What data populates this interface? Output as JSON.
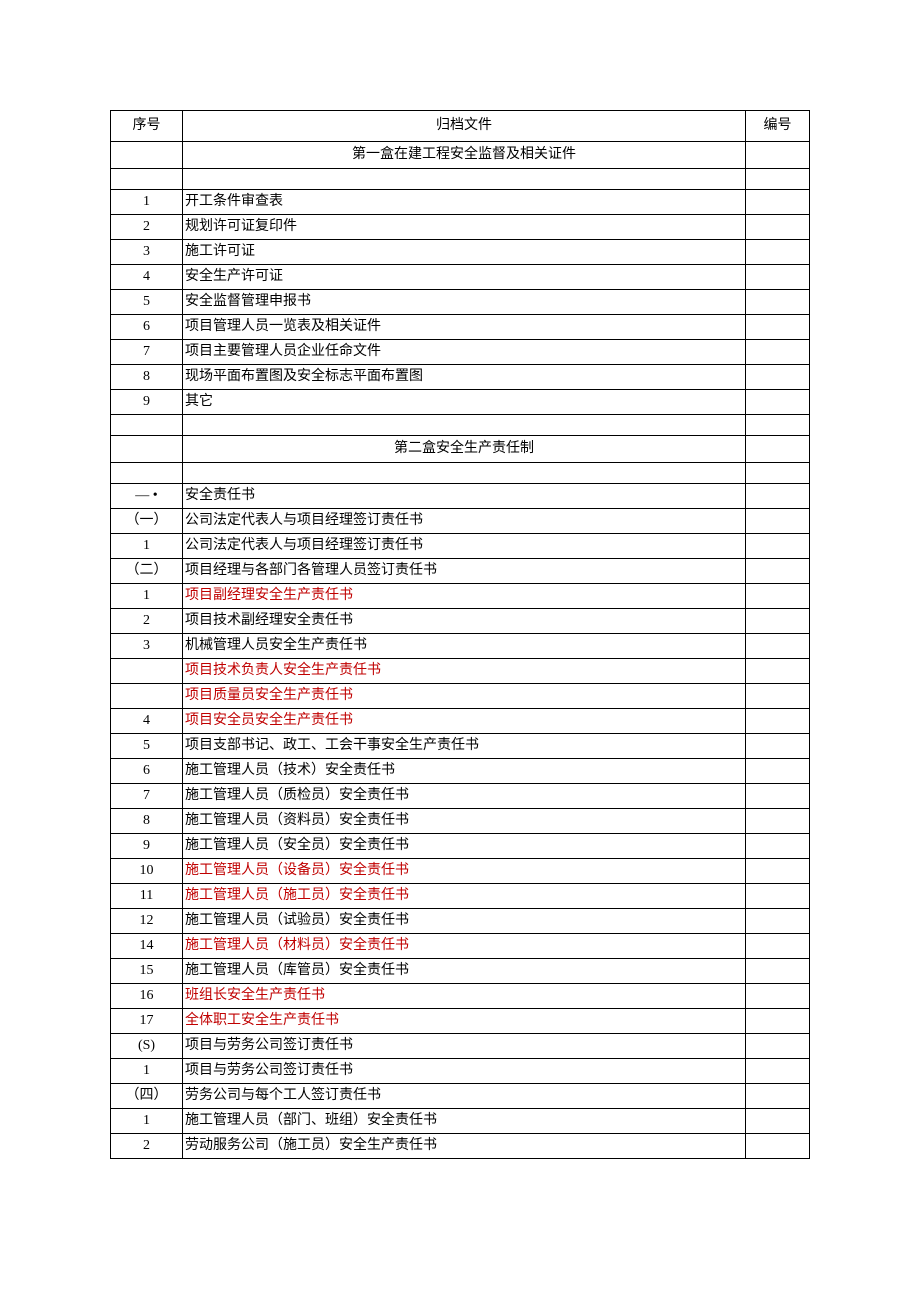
{
  "headers": {
    "seq": "序号",
    "doc": "归档文件",
    "num": "编号"
  },
  "rows": [
    {
      "type": "section",
      "doc": "第一盒在建工程安全监督及相关证件"
    },
    {
      "type": "empty"
    },
    {
      "type": "data",
      "seq": "1",
      "doc": "开工条件审查表",
      "tall": true
    },
    {
      "type": "data",
      "seq": "2",
      "doc": "规划许可证复印件"
    },
    {
      "type": "data",
      "seq": "3",
      "doc": "施工许可证"
    },
    {
      "type": "data",
      "seq": "4",
      "doc": "安全生产许可证",
      "tall": true
    },
    {
      "type": "data",
      "seq": "5",
      "doc": "安全监督管理申报书"
    },
    {
      "type": "data",
      "seq": "6",
      "doc": "项目管理人员一览表及相关证件"
    },
    {
      "type": "data",
      "seq": "7",
      "doc": "项目主要管理人员企业任命文件"
    },
    {
      "type": "data",
      "seq": "8",
      "doc": "现场平面布置图及安全标志平面布置图",
      "tall": true
    },
    {
      "type": "data",
      "seq": "9",
      "doc": "其它",
      "tall": true
    },
    {
      "type": "empty"
    },
    {
      "type": "section",
      "doc": "第二盒安全生产责任制"
    },
    {
      "type": "empty"
    },
    {
      "type": "data",
      "seq": "— •",
      "doc": "安全责任书",
      "tall": true
    },
    {
      "type": "data",
      "seq": "（一）",
      "doc": "公司法定代表人与项目经理签订责任书"
    },
    {
      "type": "data",
      "seq": "1",
      "doc": "公司法定代表人与项目经理签订责任书"
    },
    {
      "type": "data",
      "seq": "（二）",
      "doc": "项目经理与各部门各管理人员签订责任书"
    },
    {
      "type": "data",
      "seq": "1",
      "doc": "项目副经理安全生产责任书",
      "red": true
    },
    {
      "type": "data",
      "seq": "2",
      "doc": "项目技术副经理安全责任书"
    },
    {
      "type": "data",
      "seq": "3",
      "doc": "机械管理人员安全生产责任书"
    },
    {
      "type": "data",
      "seq": "",
      "doc": "项目技术负责人安全生产责任书",
      "red": true
    },
    {
      "type": "data",
      "seq": "",
      "doc": "项目质量员安全生产责任书",
      "red": true
    },
    {
      "type": "data",
      "seq": "4",
      "doc": "项目安全员安全生产责任书",
      "red": true
    },
    {
      "type": "data",
      "seq": "5",
      "doc": "项目支部书记、政工、工会干事安全生产责任书"
    },
    {
      "type": "data",
      "seq": "6",
      "doc": "施工管理人员（技术）安全责任书"
    },
    {
      "type": "data",
      "seq": "7",
      "doc": "施工管理人员（质检员）安全责任书"
    },
    {
      "type": "data",
      "seq": "8",
      "doc": "施工管理人员（资料员）安全责任书"
    },
    {
      "type": "data",
      "seq": "9",
      "doc": "施工管理人员（安全员）安全责任书"
    },
    {
      "type": "data",
      "seq": "10",
      "doc": "施工管理人员（设备员）安全责任书",
      "red": true
    },
    {
      "type": "data",
      "seq": "11",
      "doc": "施工管理人员（施工员）安全责任书",
      "red": true
    },
    {
      "type": "data",
      "seq": "12",
      "doc": "施工管理人员（试验员）安全责任书"
    },
    {
      "type": "data",
      "seq": "14",
      "doc": "施工管理人员（材料员）安全责任书",
      "red": true
    },
    {
      "type": "data",
      "seq": "15",
      "doc": "施工管理人员（库管员）安全责任书"
    },
    {
      "type": "data",
      "seq": "16",
      "doc": "班组长安全生产责任书",
      "red": true
    },
    {
      "type": "data",
      "seq": "17",
      "doc": "全体职工安全生产责任书",
      "red": true
    },
    {
      "type": "data",
      "seq": "(S)",
      "doc": "项目与劳务公司签订责任书"
    },
    {
      "type": "data",
      "seq": "1",
      "doc": "项目与劳务公司签订责任书"
    },
    {
      "type": "data",
      "seq": "（四）",
      "doc": "劳务公司与每个工人签订责任书"
    },
    {
      "type": "data",
      "seq": "1",
      "doc": "施工管理人员（部门、班组）安全责任书"
    },
    {
      "type": "data",
      "seq": "2",
      "doc": "劳动服务公司（施工员）安全生产责任书"
    }
  ]
}
